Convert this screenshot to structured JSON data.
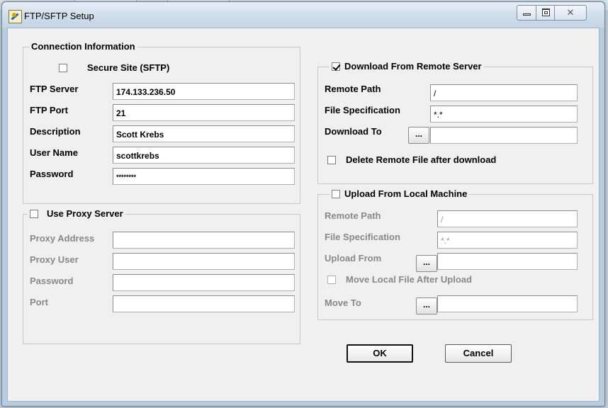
{
  "window": {
    "title": "FTP/SFTP  Setup",
    "close_glyph": "✕"
  },
  "connection": {
    "legend": "Connection Information",
    "secure_site_label": "Secure Site (SFTP)",
    "secure_site_checked": false,
    "ftp_server_label": "FTP Server",
    "ftp_server_value": "174.133.236.50",
    "ftp_port_label": "FTP Port",
    "ftp_port_value": "21",
    "description_label": "Description",
    "description_value": "Scott Krebs",
    "user_name_label": "User Name",
    "user_name_value": "scottkrebs",
    "password_label": "Password",
    "password_value": "********"
  },
  "proxy": {
    "legend": "Use Proxy Server",
    "checked": false,
    "address_label": "Proxy Address",
    "address_value": "",
    "user_label": "Proxy User",
    "user_value": "",
    "password_label": "Password",
    "password_value": "",
    "port_label": "Port",
    "port_value": ""
  },
  "download": {
    "legend": "Download From Remote Server",
    "checked": true,
    "remote_path_label": "Remote Path",
    "remote_path_value": "/",
    "file_spec_label": "File Specification",
    "file_spec_value": "*.*",
    "download_to_label": "Download To",
    "download_to_value": "",
    "browse_label": "...",
    "delete_label": "Delete Remote File after download",
    "delete_checked": false
  },
  "upload": {
    "legend": "Upload From Local Machine",
    "checked": false,
    "remote_path_label": "Remote Path",
    "remote_path_value": "/",
    "file_spec_label": "File Specification",
    "file_spec_value": "*.*",
    "upload_from_label": "Upload From",
    "upload_from_value": "",
    "browse_label": "...",
    "move_local_label": "Move Local File After Upload",
    "move_local_checked": false,
    "move_to_label": "Move To",
    "move_to_value": "",
    "move_browse_label": "..."
  },
  "buttons": {
    "ok_label": "OK",
    "cancel_label": "Cancel"
  }
}
